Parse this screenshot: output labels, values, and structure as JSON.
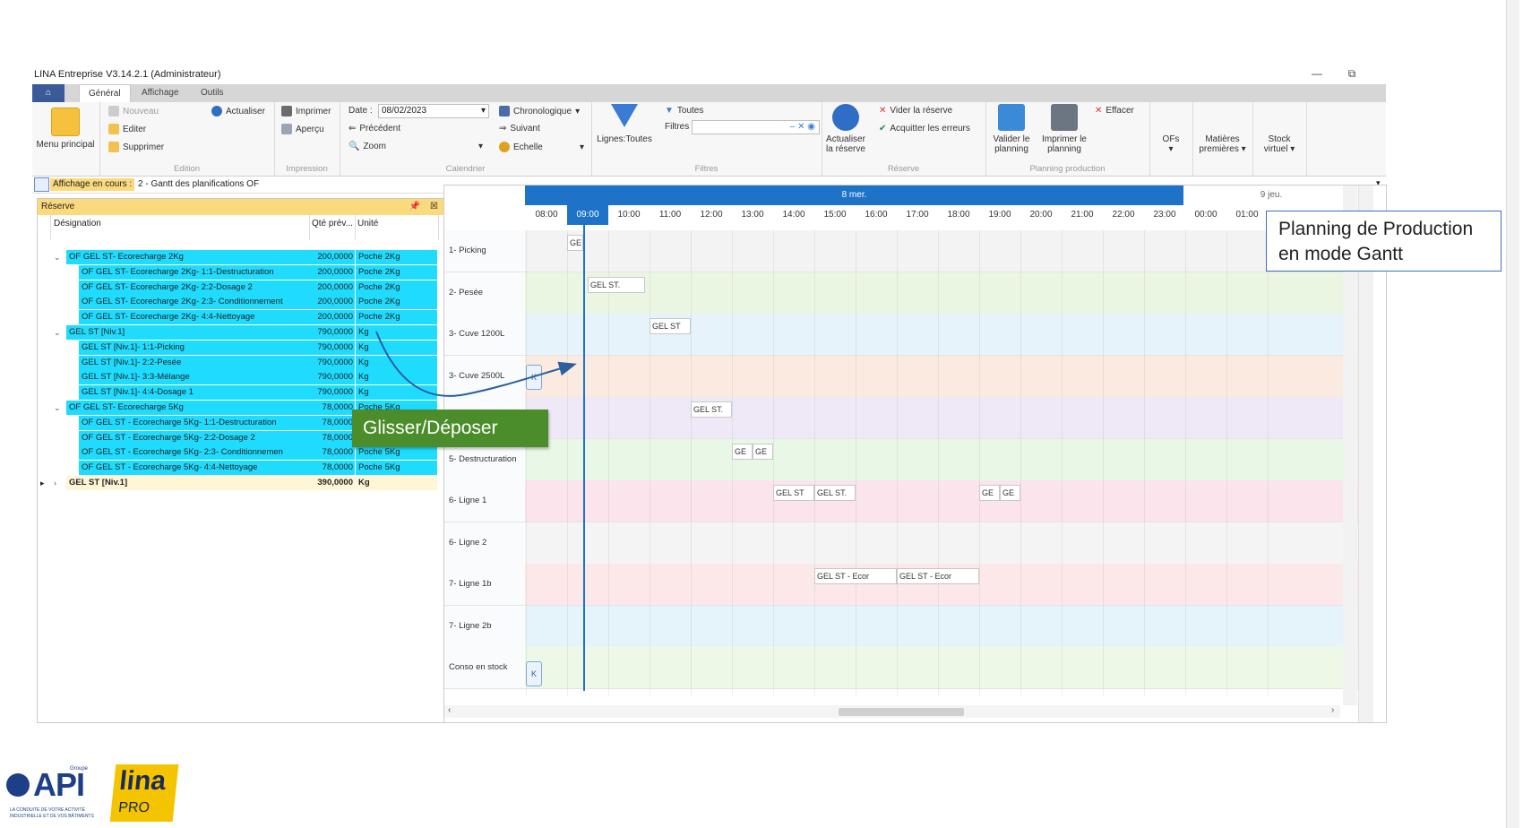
{
  "window": {
    "title": "LINA Entreprise  V3.14.2.1  (Administrateur)",
    "min_label": "—",
    "restore_label": "⧉"
  },
  "tabs": [
    {
      "label": "Général"
    },
    {
      "label": "Affichage"
    },
    {
      "label": "Outils"
    }
  ],
  "ribbon": {
    "menu_principal": "Menu principal",
    "edition": {
      "nouveau": "Nouveau",
      "actualiser": "Actualiser",
      "editer": "Editer",
      "supprimer": "Supprimer",
      "group": "Edition"
    },
    "impression": {
      "imprimer": "Imprimer",
      "apercu": "Aperçu",
      "group": "Impression"
    },
    "calendrier": {
      "date_label": "Date :",
      "date_value": "08/02/2023",
      "precedent": "Précédent",
      "zoom": "Zoom",
      "chronologique": "Chronologique",
      "suivant": "Suivant",
      "echelle": "Echelle",
      "group": "Calendrier"
    },
    "filtres": {
      "lignes": "Lignes:Toutes",
      "toutes": "Toutes",
      "filtres": "Filtres",
      "group": "Filtres"
    },
    "reserve": {
      "actualiser_l1": "Actualiser",
      "actualiser_l2": "la réserve",
      "vider": "Vider la réserve",
      "acquitter": "Acquitter les erreurs",
      "group": "Réserve"
    },
    "planning": {
      "valider_l1": "Valider le",
      "valider_l2": "planning",
      "imprimer_l1": "Imprimer le",
      "imprimer_l2": "planning",
      "effacer": "Effacer",
      "group": "Planning production"
    },
    "ofs": "OFs",
    "matieres_l1": "Matières",
    "matieres_l2": "premières",
    "stock_l1": "Stock",
    "stock_l2": "virtuel"
  },
  "affichage": {
    "label": "Affichage en cours :",
    "value": "2 - Gantt des planifications OF"
  },
  "reserve_panel": {
    "title": "Réserve",
    "columns": {
      "designation": "Désignation",
      "qte": "Qté prév...",
      "unite": "Unité"
    },
    "rows": [
      {
        "designation": "OF GEL ST- Ecorecharge 2Kg",
        "qte": "200,0000",
        "unite": "Poche 2Kg"
      },
      {
        "designation": "OF GEL ST- Ecorecharge 2Kg- 1:1-Destructuration",
        "qte": "200,0000",
        "unite": "Poche 2Kg"
      },
      {
        "designation": "OF GEL ST- Ecorecharge 2Kg- 2:2-Dosage 2",
        "qte": "200,0000",
        "unite": "Poche 2Kg"
      },
      {
        "designation": "OF GEL ST- Ecorecharge 2Kg- 2:3- Conditionnement",
        "qte": "200,0000",
        "unite": "Poche 2Kg"
      },
      {
        "designation": "OF GEL ST- Ecorecharge 2Kg- 4:4-Nettoyage",
        "qte": "200,0000",
        "unite": "Poche 2Kg"
      },
      {
        "designation": "GEL ST [Niv.1]",
        "qte": "790,0000",
        "unite": "Kg"
      },
      {
        "designation": "GEL ST [Niv.1]- 1:1-Picking",
        "qte": "790,0000",
        "unite": "Kg"
      },
      {
        "designation": "GEL ST [Niv.1]- 2:2-Pesée",
        "qte": "790,0000",
        "unite": "Kg"
      },
      {
        "designation": "GEL ST [Niv.1]- 3:3-Mélange",
        "qte": "790,0000",
        "unite": "Kg"
      },
      {
        "designation": "GEL ST [Niv.1]- 4:4-Dosage 1",
        "qte": "790,0000",
        "unite": "Kg"
      },
      {
        "designation": "OF GEL ST- Ecorecharge 5Kg",
        "qte": "78,0000",
        "unite": "Poche 5Kg"
      },
      {
        "designation": "OF GEL ST - Ecorecharge 5Kg- 1:1-Destructuration",
        "qte": "78,0000",
        "unite": "Poche 5Kg"
      },
      {
        "designation": "OF GEL ST - Ecorecharge 5Kg- 2:2-Dosage 2",
        "qte": "78,0000",
        "unite": "Poche 5Kg"
      },
      {
        "designation": "OF GEL ST - Ecorecharge 5Kg- 2:3- Conditionnemen",
        "qte": "78,0000",
        "unite": "Poche 5Kg"
      },
      {
        "designation": "OF GEL ST - Ecorecharge 5Kg- 4:4-Nettoyage",
        "qte": "78,0000",
        "unite": "Poche 5Kg"
      },
      {
        "designation": "GEL ST [Niv.1]",
        "qte": "390,0000",
        "unite": "Kg"
      }
    ]
  },
  "gantt": {
    "day_label": "8 mer.",
    "next_day_label": "9 jeu.",
    "hours": [
      "08:00",
      "09:00",
      "10:00",
      "11:00",
      "12:00",
      "13:00",
      "14:00",
      "15:00",
      "16:00",
      "17:00",
      "18:00",
      "19:00",
      "20:00",
      "21:00",
      "22:00",
      "23:00",
      "00:00",
      "01:00"
    ],
    "lanes": [
      {
        "label": "1- Picking"
      },
      {
        "label": "2- Pesée"
      },
      {
        "label": "3- Cuve 1200L"
      },
      {
        "label": "3- Cuve 2500L"
      },
      {
        "label": ""
      },
      {
        "label": "5- Destructuration"
      },
      {
        "label": "6- Ligne 1"
      },
      {
        "label": "6- Ligne 2"
      },
      {
        "label": "7- Ligne 1b"
      },
      {
        "label": "7- Ligne 2b"
      },
      {
        "label": "Conso en stock"
      }
    ],
    "tasks": [
      {
        "text": "GE"
      },
      {
        "text": "GEL ST."
      },
      {
        "text": "GEL ST"
      },
      {
        "text": "GEL ST."
      },
      {
        "text": "GE"
      },
      {
        "text": "GE"
      },
      {
        "text": "GEL ST"
      },
      {
        "text": "GEL ST."
      },
      {
        "text": "GE"
      },
      {
        "text": "GE"
      },
      {
        "text": "GEL ST - Ecor"
      },
      {
        "text": "GEL ST - Ecor"
      }
    ],
    "k_label": "K"
  },
  "callouts": {
    "planning_l1": "Planning de Production",
    "planning_l2": "en mode Gantt",
    "drag": "Glisser/Déposer"
  },
  "logos": {
    "api": "API",
    "api_groupe": "Groupe",
    "api_tag1": "LA CONDUITE DE VOTRE ACTIVITÉ",
    "api_tag2": "INDUSTRIELLE ET DE VOS BÂTIMENTS",
    "lina": "lina",
    "pro": "PRO"
  },
  "colors": {
    "accent": "#1e73c8",
    "reserve_header": "#fbd97d",
    "selected_rows": "#1fdcff",
    "drag_callout": "#4a8d2a"
  }
}
